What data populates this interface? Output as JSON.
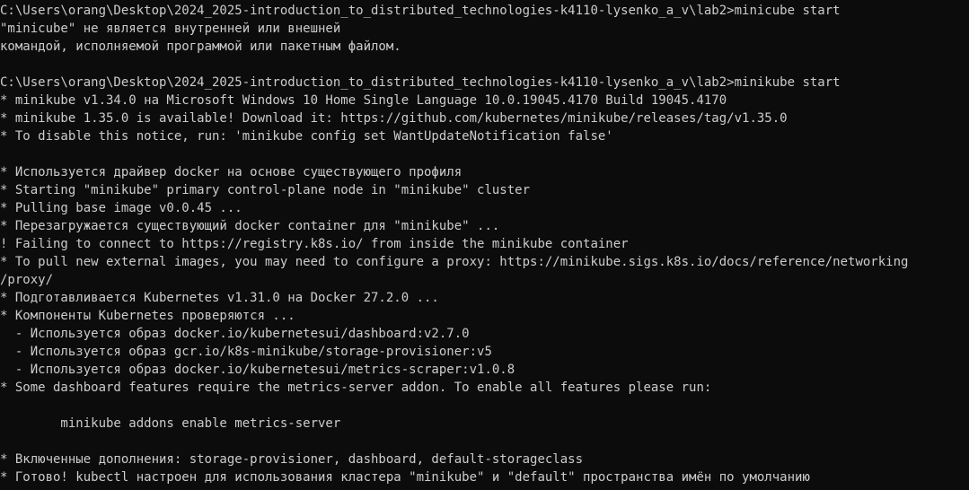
{
  "terminal": {
    "colors": {
      "background": "#0c0c0c",
      "foreground": "#cccccc"
    },
    "lines": [
      "C:\\Users\\orang\\Desktop\\2024_2025-introduction_to_distributed_technologies-k4110-lysenko_a_v\\lab2>minicube start",
      "\"minicube\" не является внутренней или внешней",
      "командой, исполняемой программой или пакетным файлом.",
      "",
      "C:\\Users\\orang\\Desktop\\2024_2025-introduction_to_distributed_technologies-k4110-lysenko_a_v\\lab2>minikube start",
      "* minikube v1.34.0 на Microsoft Windows 10 Home Single Language 10.0.19045.4170 Build 19045.4170",
      "* minikube 1.35.0 is available! Download it: https://github.com/kubernetes/minikube/releases/tag/v1.35.0",
      "* To disable this notice, run: 'minikube config set WantUpdateNotification false'",
      "",
      "* Используется драйвер docker на основе существующего профиля",
      "* Starting \"minikube\" primary control-plane node in \"minikube\" cluster",
      "* Pulling base image v0.0.45 ...",
      "* Перезагружается существующий docker container для \"minikube\" ...",
      "! Failing to connect to https://registry.k8s.io/ from inside the minikube container",
      "* To pull new external images, you may need to configure a proxy: https://minikube.sigs.k8s.io/docs/reference/networking",
      "/proxy/",
      "* Подготавливается Kubernetes v1.31.0 на Docker 27.2.0 ...",
      "* Компоненты Kubernetes проверяются ...",
      "  - Используется образ docker.io/kubernetesui/dashboard:v2.7.0",
      "  - Используется образ gcr.io/k8s-minikube/storage-provisioner:v5",
      "  - Используется образ docker.io/kubernetesui/metrics-scraper:v1.0.8",
      "* Some dashboard features require the metrics-server addon. To enable all features please run:",
      "",
      "        minikube addons enable metrics-server",
      "",
      "* Включенные дополнения: storage-provisioner, dashboard, default-storageclass",
      "* Готово! kubectl настроен для использования кластера \"minikube\" и \"default\" пространства имён по умолчанию"
    ]
  }
}
